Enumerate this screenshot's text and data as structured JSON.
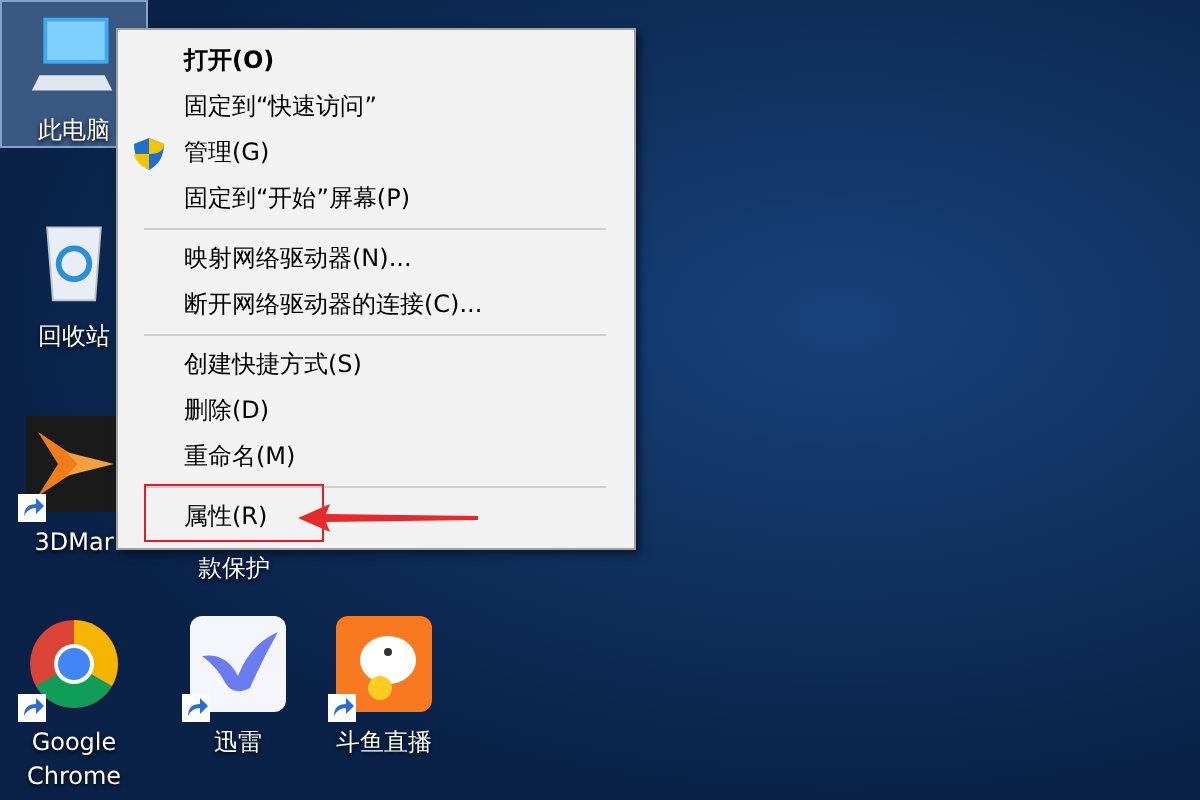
{
  "desktop_icons": [
    {
      "label": "此电脑",
      "kind": "computer",
      "selected": true,
      "shortcut": false
    },
    {
      "label": "回收站",
      "kind": "recycle-bin",
      "selected": false,
      "shortcut": false
    },
    {
      "label": "3DMar",
      "kind": "benchmark",
      "selected": false,
      "shortcut": true
    },
    {
      "label": "款保护",
      "kind": "covered",
      "selected": false
    },
    {
      "label": "Google Chrome",
      "kind": "chrome",
      "selected": false,
      "shortcut": true
    },
    {
      "label": "迅雷",
      "kind": "bird",
      "selected": false,
      "shortcut": true
    },
    {
      "label": "斗鱼直播",
      "kind": "fish",
      "selected": false,
      "shortcut": true
    }
  ],
  "context_menu": {
    "items": [
      {
        "kind": "item",
        "label": "打开(O)",
        "default": true,
        "shield": false,
        "annotated": false
      },
      {
        "kind": "item",
        "label": "固定到“快速访问”",
        "default": false,
        "shield": false,
        "annotated": false
      },
      {
        "kind": "item",
        "label": "管理(G)",
        "default": false,
        "shield": true,
        "annotated": false
      },
      {
        "kind": "item",
        "label": "固定到“开始”屏幕(P)",
        "default": false,
        "shield": false,
        "annotated": false
      },
      {
        "kind": "separator"
      },
      {
        "kind": "item",
        "label": "映射网络驱动器(N)...",
        "default": false,
        "shield": false,
        "annotated": false
      },
      {
        "kind": "item",
        "label": "断开网络驱动器的连接(C)...",
        "default": false,
        "shield": false,
        "annotated": false
      },
      {
        "kind": "separator"
      },
      {
        "kind": "item",
        "label": "创建快捷方式(S)",
        "default": false,
        "shield": false,
        "annotated": false
      },
      {
        "kind": "item",
        "label": "删除(D)",
        "default": false,
        "shield": false,
        "annotated": false
      },
      {
        "kind": "item",
        "label": "重命名(M)",
        "default": false,
        "shield": false,
        "annotated": false
      },
      {
        "kind": "separator"
      },
      {
        "kind": "item",
        "label": "属性(R)",
        "default": false,
        "shield": false,
        "annotated": true
      }
    ]
  }
}
